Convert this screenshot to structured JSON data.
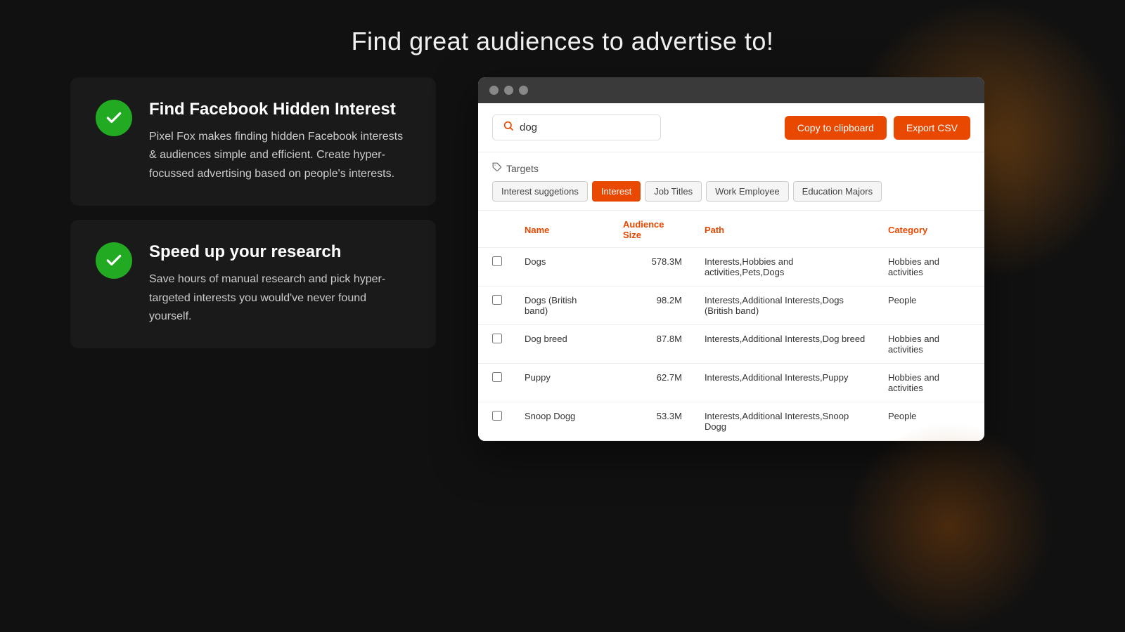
{
  "header": {
    "title": "Find great audiences to advertise to!"
  },
  "features": [
    {
      "id": "feature-1",
      "heading": "Find Facebook Hidden Interest",
      "description": "Pixel Fox makes finding hidden Facebook interests & audiences simple and efficient. Create hyper-focussed advertising based on people's interests."
    },
    {
      "id": "feature-2",
      "heading": "Speed up your research",
      "description": "Save hours of manual research and pick hyper-targeted interests you would've never found yourself."
    }
  ],
  "app_window": {
    "search": {
      "value": "dog",
      "placeholder": "Search...",
      "search_icon": "search-icon"
    },
    "buttons": {
      "copy": "Copy to clipboard",
      "export": "Export CSV"
    },
    "targets": {
      "label": "Targets",
      "tabs": [
        {
          "id": "interest-suggestions",
          "label": "Interest suggetions",
          "active": false
        },
        {
          "id": "interest",
          "label": "Interest",
          "active": true
        },
        {
          "id": "job-titles",
          "label": "Job Titles",
          "active": false
        },
        {
          "id": "work-employee",
          "label": "Work Employee",
          "active": false
        },
        {
          "id": "education-majors",
          "label": "Education Majors",
          "active": false
        }
      ]
    },
    "table": {
      "columns": [
        {
          "id": "checkbox",
          "label": ""
        },
        {
          "id": "name",
          "label": "Name"
        },
        {
          "id": "audience_size",
          "label": "Audience Size"
        },
        {
          "id": "path",
          "label": "Path"
        },
        {
          "id": "category",
          "label": "Category"
        }
      ],
      "rows": [
        {
          "name": "Dogs",
          "audience_size": "578.3M",
          "path": "Interests,Hobbies and activities,Pets,Dogs",
          "category": "Hobbies and activities"
        },
        {
          "name": "Dogs (British band)",
          "audience_size": "98.2M",
          "path": "Interests,Additional Interests,Dogs (British band)",
          "category": "People"
        },
        {
          "name": "Dog breed",
          "audience_size": "87.8M",
          "path": "Interests,Additional Interests,Dog breed",
          "category": "Hobbies and activities"
        },
        {
          "name": "Puppy",
          "audience_size": "62.7M",
          "path": "Interests,Additional Interests,Puppy",
          "category": "Hobbies and activities"
        },
        {
          "name": "Snoop Dogg",
          "audience_size": "53.3M",
          "path": "Interests,Additional Interests,Snoop Dogg",
          "category": "People"
        }
      ]
    }
  }
}
